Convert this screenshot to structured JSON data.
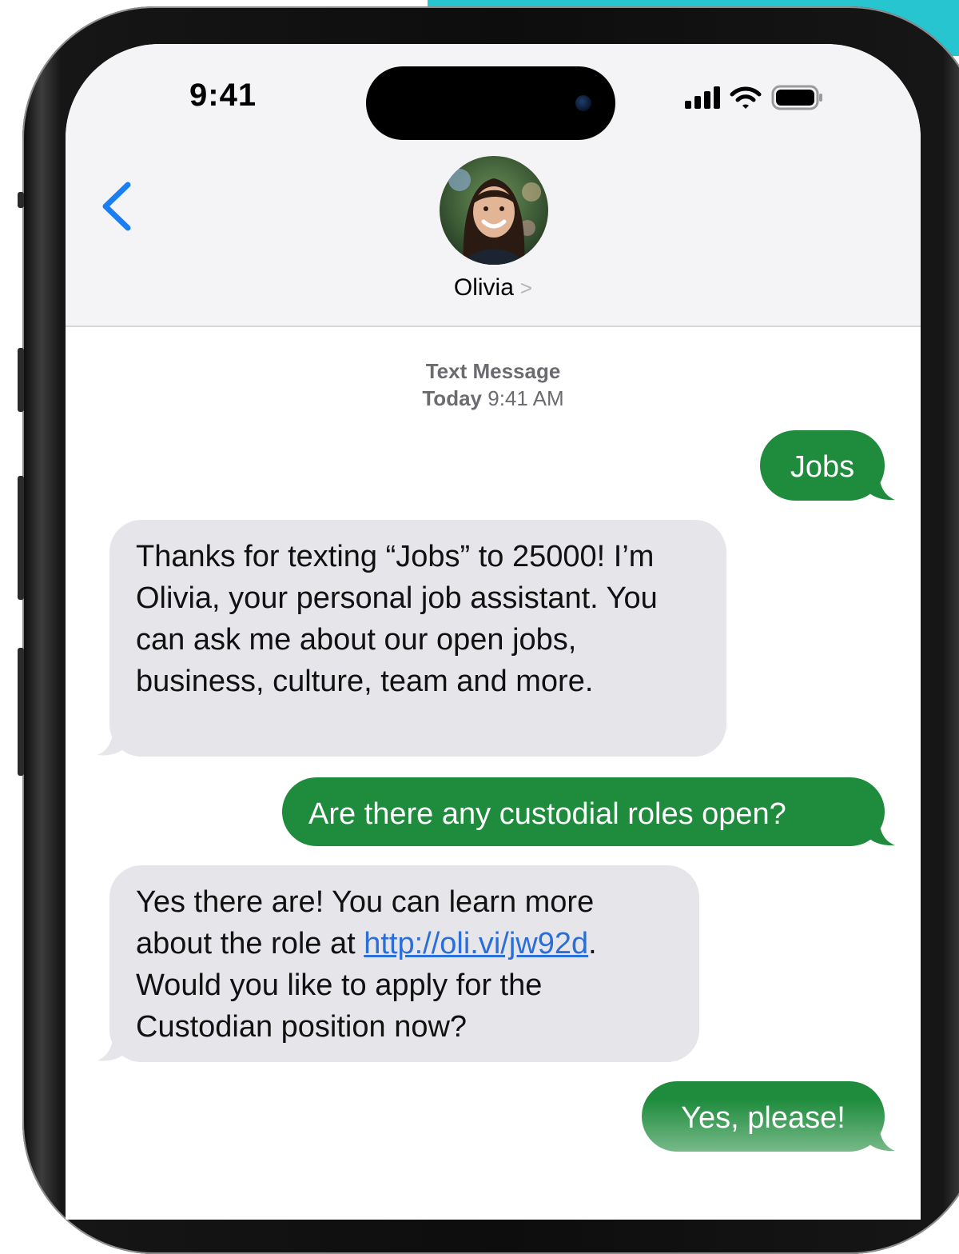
{
  "status": {
    "time": "9:41"
  },
  "contact": {
    "name": "Olivia",
    "chevron": ">"
  },
  "meta": {
    "line1": "Text Message",
    "day": "Today",
    "time": "9:41 AM"
  },
  "messages": [
    {
      "from": "me",
      "text": "Jobs"
    },
    {
      "from": "them",
      "text": "Thanks for texting “Jobs” to 25000! I’m Olivia, your personal job assistant. You can ask me about our open jobs, business, culture, team and more."
    },
    {
      "from": "me",
      "text": "Are there any custodial roles open?"
    },
    {
      "from": "them",
      "before": "Yes there are! You can learn more about the role at ",
      "link": "http://oli.vi/jw92d",
      "after": ". Would you like to apply for the Custodian position now?"
    },
    {
      "from": "me",
      "text": "Yes, please!"
    }
  ],
  "colors": {
    "accent": "#27c5d0",
    "outgoing": "#1f8c3d",
    "incoming": "#e5e5ea",
    "link": "#2a6fd8",
    "back": "#1a7ef5"
  },
  "icons": [
    "back-chevron-icon",
    "signal-icon",
    "wifi-icon",
    "battery-icon"
  ]
}
